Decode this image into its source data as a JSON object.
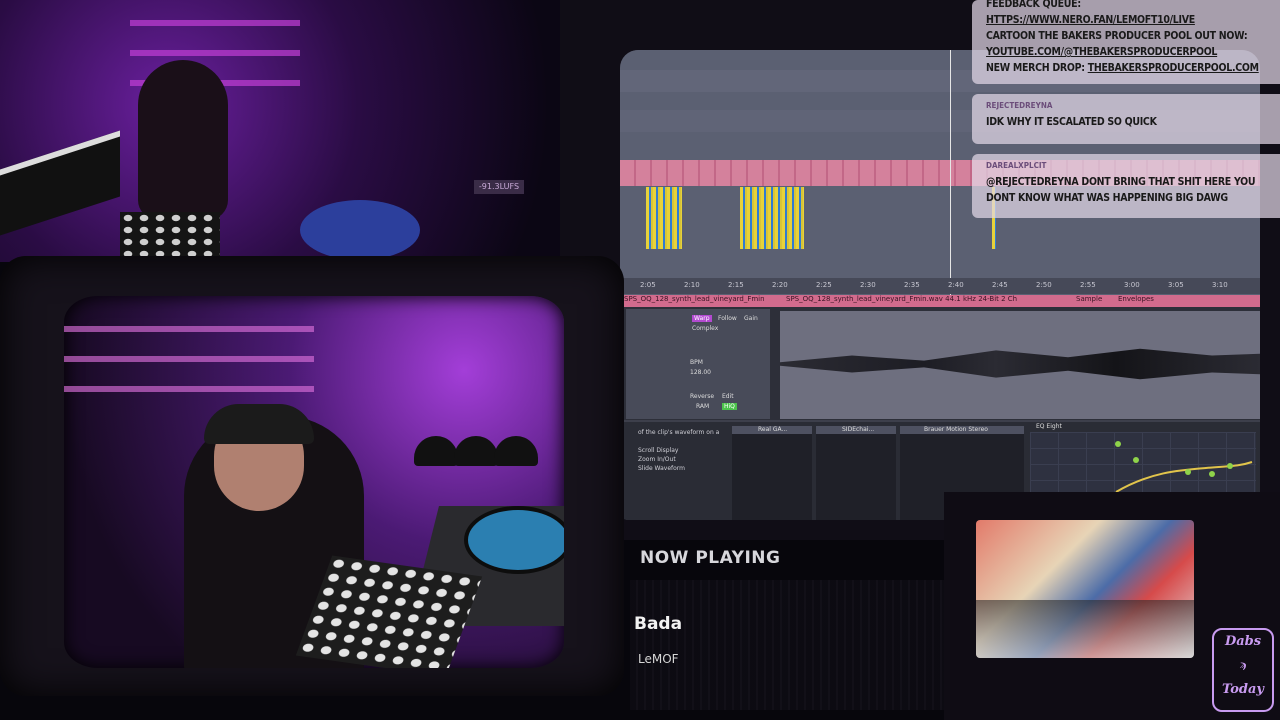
{
  "overlay": {
    "now_playing_label": "NOW PLAYING",
    "track_title": "Bada",
    "track_artist": "LeMOF",
    "lufs_readout": "-91.3LUFS"
  },
  "chat": {
    "announcement": {
      "line1": "FEEDBACK QUEUE:",
      "link1": "HTTPS://WWW.NERO.FAN/LEMOFT10/LIVE",
      "line2": "CARTOON THE BAKERS PRODUCER POOL OUT NOW:",
      "link2": "YOUTUBE.COM/@THEBAKERSPRODUCERPOOL",
      "line3_prefix": "NEW MERCH DROP:",
      "link3": "THEBAKERSPRODUCERPOOL.COM"
    },
    "messages": [
      {
        "user": "REJECTEDREYNA",
        "text": "IDK WHY IT ESCALATED SO QUICK"
      },
      {
        "user": "DAREALXPLCIT",
        "text": "@REJECTEDREYNA DONT BRING THAT SHIT HERE YOU DONT KNOW WHAT WAS HAPPENING BIG DAWG"
      }
    ]
  },
  "daw": {
    "ruler_ticks": [
      "2:05",
      "2:10",
      "2:15",
      "2:20",
      "2:25",
      "2:30",
      "2:35",
      "2:40",
      "2:45",
      "2:50",
      "2:55",
      "3:00",
      "3:05",
      "3:10"
    ],
    "clip_name": "SPS_OQ_128_synth_lead_vineyard_Fmin",
    "clip_file": "SPS_OQ_128_synth_lead_vineyard_Fmin.wav  44.1 kHz  24-Bit  2 Ch",
    "sample_tab": "Sample",
    "envelopes_tab": "Envelopes",
    "warp_label": "Warp",
    "follow_label": "Follow",
    "complex_label": "Complex",
    "bpm_label": "BPM",
    "bpm_value": "128.00",
    "gain_label": "Gain",
    "reverse_label": "Reverse",
    "edit_label": "Edit",
    "ram_label": "RAM",
    "hiq_label": "HiQ",
    "devices": [
      "Real GA...",
      "SIDEchai...",
      "Brauer Motion Stereo",
      "EQ Eight"
    ],
    "info_lines": [
      "of the clip's waveform on a",
      "Scroll Display",
      "Zoom In/Out",
      "Slide Waveform"
    ]
  },
  "logo": {
    "line1": "Dabs",
    "line2": "Today"
  },
  "colors": {
    "accent": "#d26b8d",
    "chat_bg": "#e2d7e6",
    "clip_yellow": "#e7d23a"
  }
}
